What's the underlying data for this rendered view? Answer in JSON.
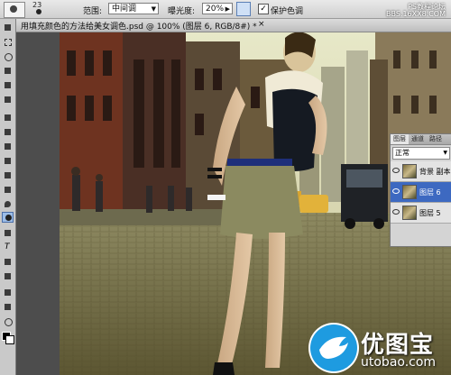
{
  "options_bar": {
    "brush_size": "23",
    "range_label": "范围:",
    "range_value": "中间调",
    "exposure_label": "曝光度:",
    "exposure_value": "20%",
    "protect_tones_label": "保护色调",
    "protect_tones_checked": "✓"
  },
  "document": {
    "title": "用填充颜色的方法给美女调色.psd @ 100% (图层 6, RGB/8#) *",
    "close": "×"
  },
  "watermark": {
    "line1": "PS教程论坛",
    "line2": "BBS.16XX8.COM"
  },
  "layers_panel": {
    "tabs": [
      "图层",
      "通道",
      "路径"
    ],
    "blend_mode": "正常",
    "layers": [
      {
        "name": "背景 副本",
        "selected": false
      },
      {
        "name": "图层 6",
        "selected": true
      },
      {
        "name": "图层 5",
        "selected": false
      }
    ]
  },
  "logo": {
    "cn": "优图宝",
    "en": "utobao.com"
  },
  "colors": {
    "selection_blue": "#3d69c1",
    "logo_blue": "#1e9be0"
  }
}
